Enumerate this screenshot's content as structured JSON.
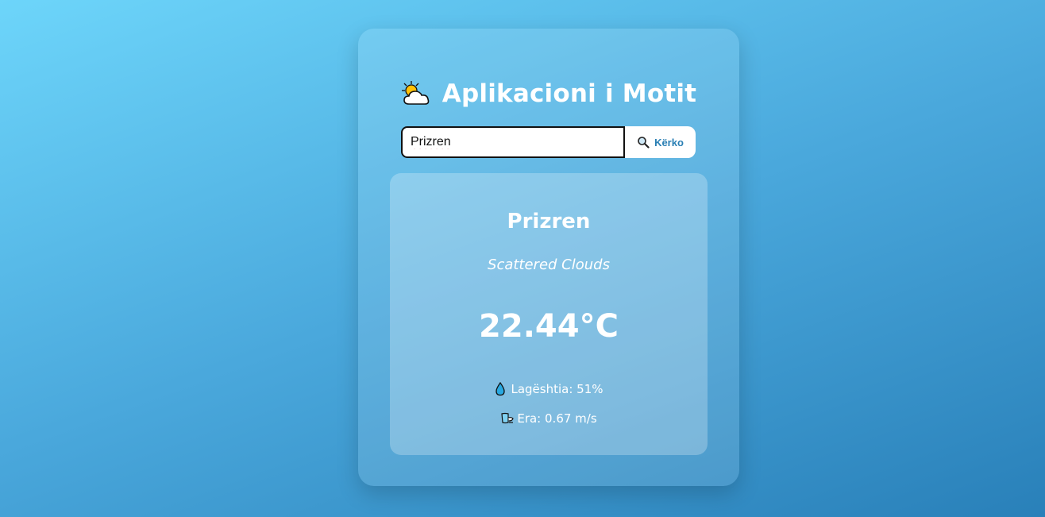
{
  "app": {
    "title": "Aplikacioni i Motit",
    "title_icon": "sun-behind-cloud-icon"
  },
  "search": {
    "value": "Prizren",
    "button_label": "Kërko",
    "button_icon": "magnifying-glass-icon"
  },
  "weather": {
    "city": "Prizren",
    "description": "Scattered Clouds",
    "temperature": "22.44°C",
    "humidity": {
      "icon": "droplet-icon",
      "text": "Lagështia: 51%"
    },
    "wind": {
      "icon": "wind-icon",
      "text": "Era: 0.67 m/s"
    }
  },
  "colors": {
    "background_start": "#6dd5fa",
    "background_end": "#2980b9",
    "accent": "#2a7fb4",
    "text": "#ffffff"
  }
}
